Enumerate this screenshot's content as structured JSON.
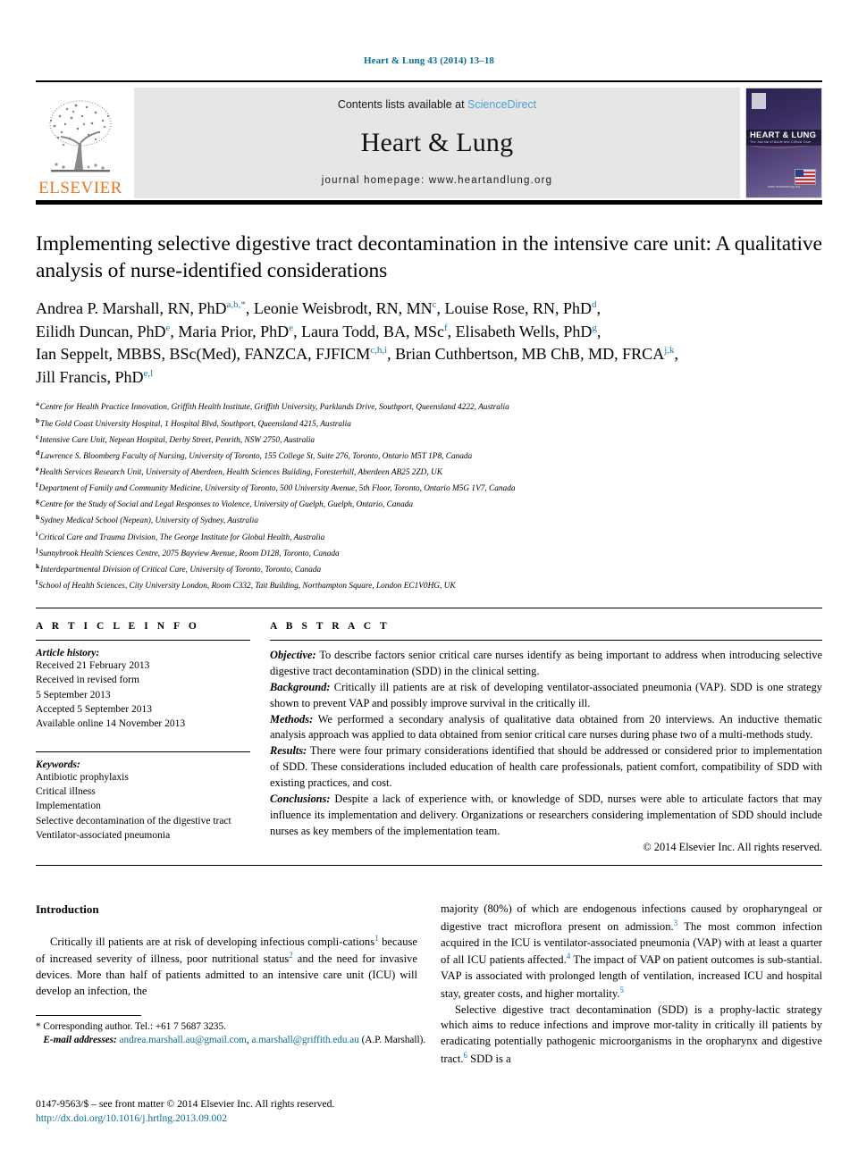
{
  "running_head": "Heart & Lung 43 (2014) 13–18",
  "masthead": {
    "contents_prefix": "Contents lists available at ",
    "sciencedirect": "ScienceDirect",
    "journal_title": "Heart & Lung",
    "homepage": "journal homepage: www.heartandlung.org",
    "publisher": "ELSEVIER",
    "cover_title": "HEART & LUNG",
    "cover_subtitle": "The Journal of Acute and Critical Care",
    "cover_url": "www.heartandlung.org"
  },
  "article": {
    "title": "Implementing selective digestive tract decontamination in the intensive care unit: A qualitative analysis of nurse-identified considerations",
    "authors_lines": [
      "Andrea P. Marshall, RN, PhD",
      "Leonie Weisbrodt, RN, MN",
      "Louise Rose, RN, PhD",
      "Eilidh Duncan, PhD",
      "Maria Prior, PhD",
      "Laura Todd, BA, MSc",
      "Elisabeth Wells, PhD",
      "Ian Seppelt, MBBS, BSc(Med), FANZCA, FJFICM",
      "Brian Cuthbertson, MB ChB, MD, FRCA",
      "Jill Francis, PhD"
    ],
    "author_marks": [
      "a,b,*",
      "c",
      "d",
      "e",
      "e",
      "f",
      "g",
      "c,h,i",
      "j,k",
      "e,l"
    ],
    "affiliations": [
      {
        "mark": "a",
        "text": "Centre for Health Practice Innovation, Griffith Health Institute, Griffith University, Parklands Drive, Southport, Queensland 4222, Australia"
      },
      {
        "mark": "b",
        "text": "The Gold Coast University Hospital, 1 Hospital Blvd, Southport, Queensland 4215, Australia"
      },
      {
        "mark": "c",
        "text": "Intensive Care Unit, Nepean Hospital, Derby Street, Penrith, NSW 2750, Australia"
      },
      {
        "mark": "d",
        "text": "Lawrence S. Bloomberg Faculty of Nursing, University of Toronto, 155 College St, Suite 276, Toronto, Ontario M5T 1P8, Canada"
      },
      {
        "mark": "e",
        "text": "Health Services Research Unit, University of Aberdeen, Health Sciences Building, Foresterhill, Aberdeen AB25 2ZD, UK"
      },
      {
        "mark": "f",
        "text": "Department of Family and Community Medicine, University of Toronto, 500 University Avenue, 5th Floor, Toronto, Ontario M5G 1V7, Canada"
      },
      {
        "mark": "g",
        "text": "Centre for the Study of Social and Legal Responses to Violence, University of Guelph, Guelph, Ontario, Canada"
      },
      {
        "mark": "h",
        "text": "Sydney Medical School (Nepean), University of Sydney, Australia"
      },
      {
        "mark": "i",
        "text": "Critical Care and Trauma Division, The George Institute for Global Health, Australia"
      },
      {
        "mark": "j",
        "text": "Sunnybrook Health Sciences Centre, 2075 Bayview Avenue, Room D128, Toronto, Canada"
      },
      {
        "mark": "k",
        "text": "Interdepartmental Division of Critical Care, University of Toronto, Toronto, Canada"
      },
      {
        "mark": "l",
        "text": "School of Health Sciences, City University London, Room C332, Tait Building, Northampton Square, London EC1V0HG, UK"
      }
    ]
  },
  "article_info": {
    "heading": "A R T I C L E  I N F O",
    "history_label": "Article history:",
    "history": [
      "Received 21 February 2013",
      "Received in revised form",
      "5 September 2013",
      "Accepted 5 September 2013",
      "Available online 14 November 2013"
    ],
    "keywords_label": "Keywords:",
    "keywords": [
      "Antibiotic prophylaxis",
      "Critical illness",
      "Implementation",
      "Selective decontamination of the digestive tract",
      "Ventilator-associated pneumonia"
    ]
  },
  "abstract": {
    "heading": "A B S T R A C T",
    "sections": [
      {
        "label": "Objective:",
        "text": " To describe factors senior critical care nurses identify as being important to address when introducing selective digestive tract decontamination (SDD) in the clinical setting."
      },
      {
        "label": "Background:",
        "text": " Critically ill patients are at risk of developing ventilator-associated pneumonia (VAP). SDD is one strategy shown to prevent VAP and possibly improve survival in the critically ill."
      },
      {
        "label": "Methods:",
        "text": " We performed a secondary analysis of qualitative data obtained from 20 interviews. An inductive thematic analysis approach was applied to data obtained from senior critical care nurses during phase two of a multi-methods study."
      },
      {
        "label": "Results:",
        "text": " There were four primary considerations identified that should be addressed or considered prior to implementation of SDD. These considerations included education of health care professionals, patient comfort, compatibility of SDD with existing practices, and cost."
      },
      {
        "label": "Conclusions:",
        "text": " Despite a lack of experience with, or knowledge of SDD, nurses were able to articulate factors that may influence its implementation and delivery. Organizations or researchers considering implementation of SDD should include nurses as key members of the implementation team."
      }
    ],
    "copyright": "© 2014 Elsevier Inc. All rights reserved."
  },
  "body": {
    "intro_heading": "Introduction",
    "left_paragraph_parts": [
      "Critically ill patients are at risk of developing infectious compli-cations",
      "1",
      " because of increased severity of illness, poor nutritional status",
      "2",
      " and the need for invasive devices. More than half of patients admitted to an intensive care unit (ICU) will develop an infection, the"
    ],
    "right_paragraph_1_parts": [
      "majority (80%) of which are endogenous infections caused by oropharyngeal or digestive tract microflora present on admission.",
      "3",
      " The most common infection acquired in the ICU is ventilator-associated pneumonia (VAP) with at least a quarter of all ICU patients affected.",
      "4",
      " The impact of VAP on patient outcomes is sub-stantial. VAP is associated with prolonged length of ventilation, increased ICU and hospital stay, greater costs, and higher mortality.",
      "5"
    ],
    "right_paragraph_2_parts": [
      "Selective digestive tract decontamination (SDD) is a prophy-lactic strategy which aims to reduce infections and improve mor-tality in critically ill patients by eradicating potentially pathogenic microorganisms in the oropharynx and digestive tract.",
      "6",
      " SDD is a"
    ]
  },
  "footnote": {
    "corresponding": "* Corresponding author. Tel.: +61 7 5687 3235.",
    "email_label": "E-mail addresses:",
    "email1": "andrea.marshall.au@gmail.com",
    "email_sep": ", ",
    "email2": "a.marshall@griffith.edu.au",
    "attribution": "(A.P. Marshall)."
  },
  "bottom": {
    "issn_line": "0147-9563/$ – see front matter © 2014 Elsevier Inc. All rights reserved.",
    "doi": "http://dx.doi.org/10.1016/j.hrtlng.2013.09.002"
  },
  "colors": {
    "link": "#0a6e96",
    "sciencedirect": "#4ca3d4",
    "superscript": "#1a7bb0",
    "elsevier_orange": "#E87722"
  }
}
